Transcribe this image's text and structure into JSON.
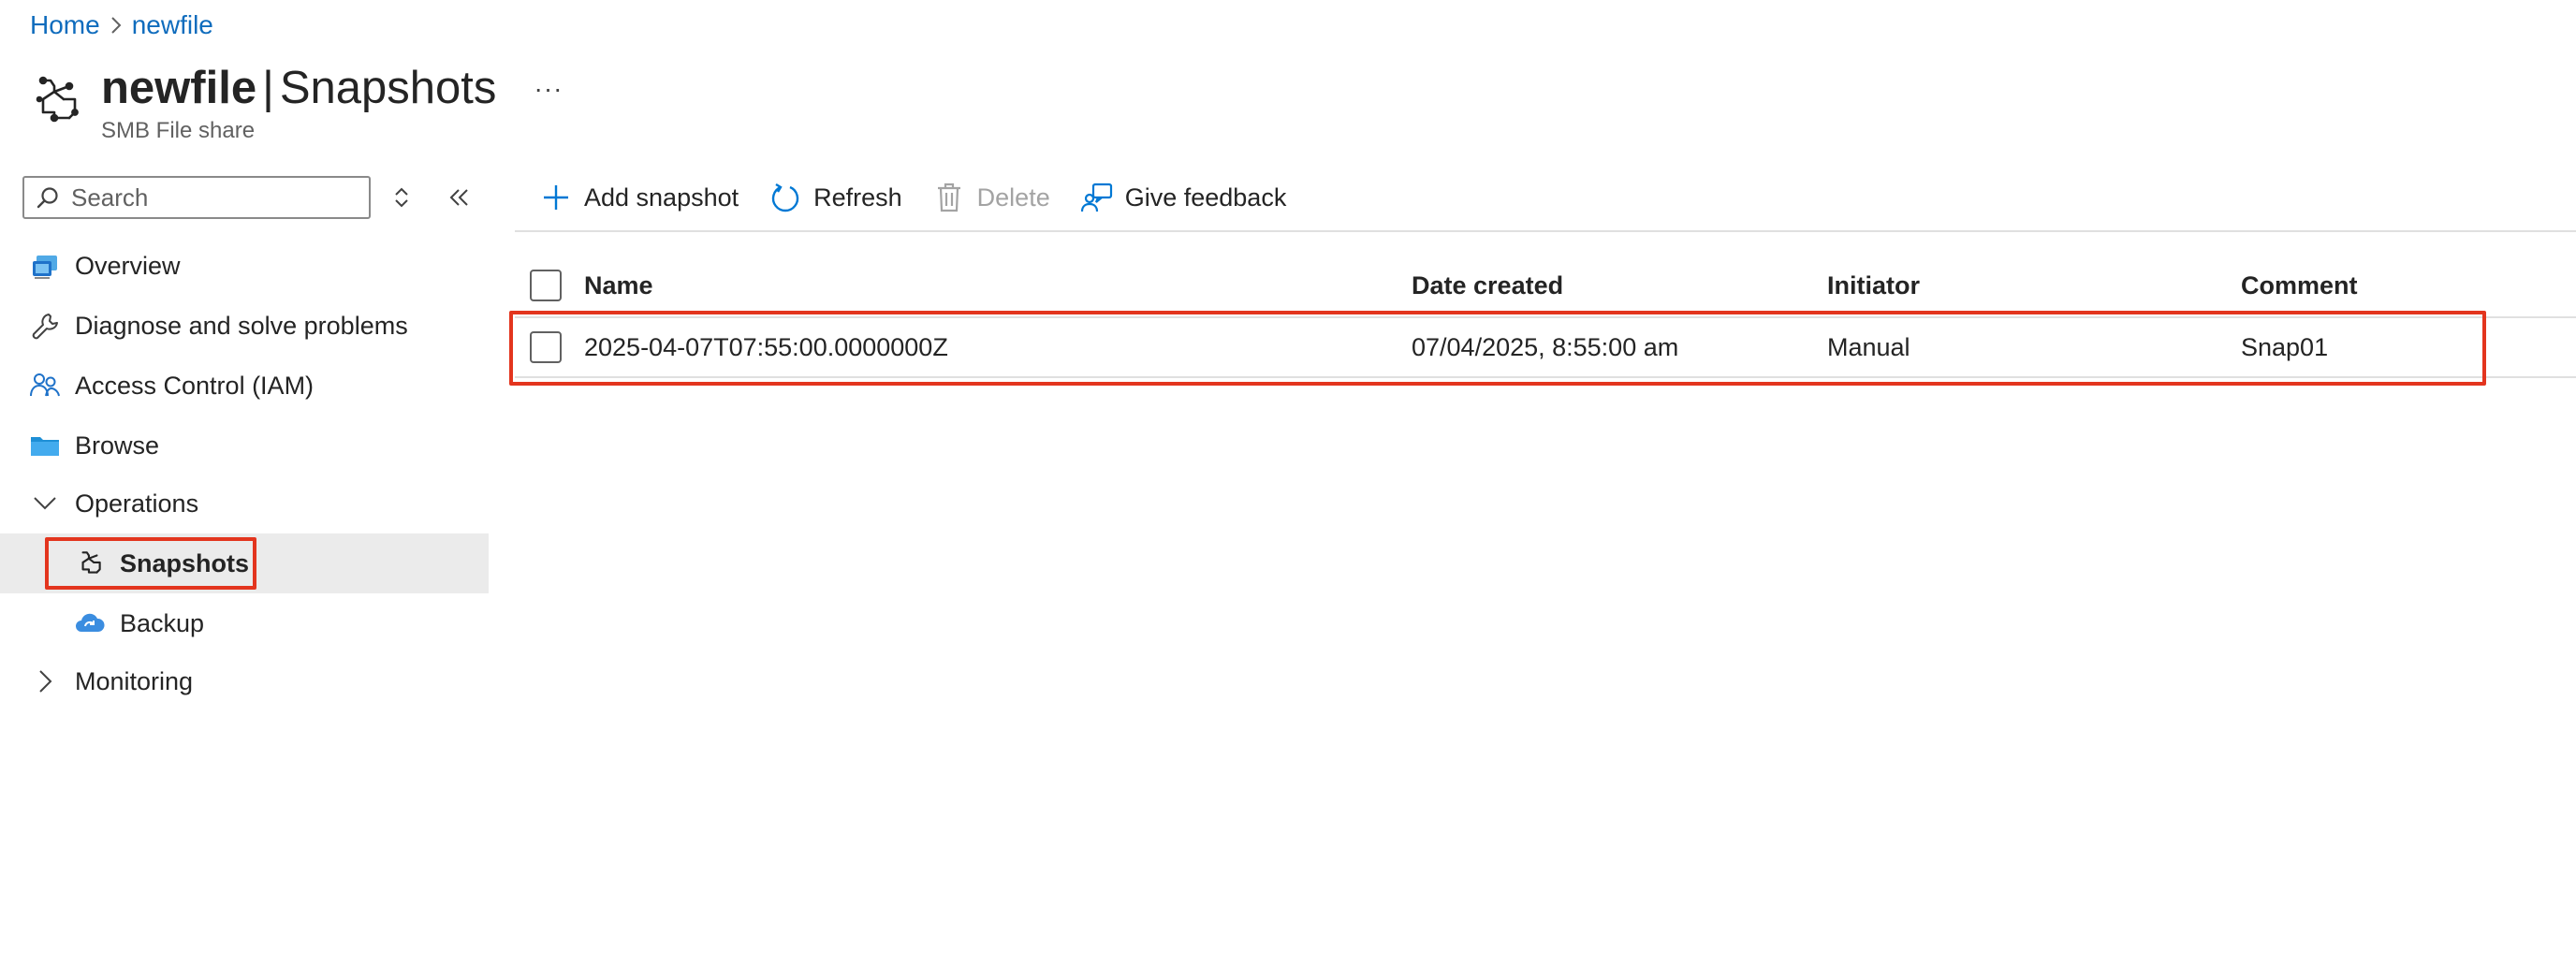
{
  "breadcrumb": {
    "home": "Home",
    "resource": "newfile"
  },
  "header": {
    "resource_name": "newfile",
    "separator": "|",
    "page_name": "Snapshots",
    "subtitle": "SMB File share",
    "more": "···",
    "icon": "snapshot-icon"
  },
  "sidebar": {
    "search_placeholder": "Search",
    "items": [
      {
        "label": "Overview",
        "icon": "overview-icon"
      },
      {
        "label": "Diagnose and solve problems",
        "icon": "wrench-icon"
      },
      {
        "label": "Access Control (IAM)",
        "icon": "people-icon"
      },
      {
        "label": "Browse",
        "icon": "folder-icon"
      },
      {
        "label": "Operations",
        "icon": "chevron-down-icon",
        "expanded": true
      },
      {
        "label": "Snapshots",
        "icon": "snapshot-icon",
        "selected": true
      },
      {
        "label": "Backup",
        "icon": "backup-cloud-icon"
      },
      {
        "label": "Monitoring",
        "icon": "chevron-right-icon",
        "expanded": false
      }
    ]
  },
  "toolbar": {
    "add": "Add snapshot",
    "refresh": "Refresh",
    "delete": "Delete",
    "feedback": "Give feedback"
  },
  "grid": {
    "columns": [
      "Name",
      "Date created",
      "Initiator",
      "Comment"
    ],
    "rows": [
      {
        "name": "2025-04-07T07:55:00.0000000Z",
        "date_created": "07/04/2025, 8:55:00 am",
        "initiator": "Manual",
        "comment": "Snap01"
      }
    ]
  },
  "colors": {
    "link": "#0f6cbd",
    "highlight": "#e3351e",
    "selected_bg": "#ebebeb",
    "accent": "#0078d4"
  }
}
